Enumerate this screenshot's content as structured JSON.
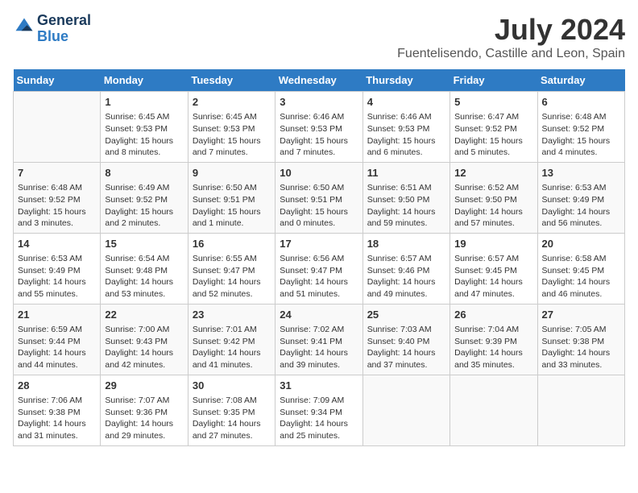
{
  "header": {
    "logo_line1": "General",
    "logo_line2": "Blue",
    "month": "July 2024",
    "location": "Fuentelisendo, Castille and Leon, Spain"
  },
  "days_of_week": [
    "Sunday",
    "Monday",
    "Tuesday",
    "Wednesday",
    "Thursday",
    "Friday",
    "Saturday"
  ],
  "weeks": [
    [
      {
        "num": "",
        "info": ""
      },
      {
        "num": "1",
        "info": "Sunrise: 6:45 AM\nSunset: 9:53 PM\nDaylight: 15 hours\nand 8 minutes."
      },
      {
        "num": "2",
        "info": "Sunrise: 6:45 AM\nSunset: 9:53 PM\nDaylight: 15 hours\nand 7 minutes."
      },
      {
        "num": "3",
        "info": "Sunrise: 6:46 AM\nSunset: 9:53 PM\nDaylight: 15 hours\nand 7 minutes."
      },
      {
        "num": "4",
        "info": "Sunrise: 6:46 AM\nSunset: 9:53 PM\nDaylight: 15 hours\nand 6 minutes."
      },
      {
        "num": "5",
        "info": "Sunrise: 6:47 AM\nSunset: 9:52 PM\nDaylight: 15 hours\nand 5 minutes."
      },
      {
        "num": "6",
        "info": "Sunrise: 6:48 AM\nSunset: 9:52 PM\nDaylight: 15 hours\nand 4 minutes."
      }
    ],
    [
      {
        "num": "7",
        "info": "Sunrise: 6:48 AM\nSunset: 9:52 PM\nDaylight: 15 hours\nand 3 minutes."
      },
      {
        "num": "8",
        "info": "Sunrise: 6:49 AM\nSunset: 9:52 PM\nDaylight: 15 hours\nand 2 minutes."
      },
      {
        "num": "9",
        "info": "Sunrise: 6:50 AM\nSunset: 9:51 PM\nDaylight: 15 hours\nand 1 minute."
      },
      {
        "num": "10",
        "info": "Sunrise: 6:50 AM\nSunset: 9:51 PM\nDaylight: 15 hours\nand 0 minutes."
      },
      {
        "num": "11",
        "info": "Sunrise: 6:51 AM\nSunset: 9:50 PM\nDaylight: 14 hours\nand 59 minutes."
      },
      {
        "num": "12",
        "info": "Sunrise: 6:52 AM\nSunset: 9:50 PM\nDaylight: 14 hours\nand 57 minutes."
      },
      {
        "num": "13",
        "info": "Sunrise: 6:53 AM\nSunset: 9:49 PM\nDaylight: 14 hours\nand 56 minutes."
      }
    ],
    [
      {
        "num": "14",
        "info": "Sunrise: 6:53 AM\nSunset: 9:49 PM\nDaylight: 14 hours\nand 55 minutes."
      },
      {
        "num": "15",
        "info": "Sunrise: 6:54 AM\nSunset: 9:48 PM\nDaylight: 14 hours\nand 53 minutes."
      },
      {
        "num": "16",
        "info": "Sunrise: 6:55 AM\nSunset: 9:47 PM\nDaylight: 14 hours\nand 52 minutes."
      },
      {
        "num": "17",
        "info": "Sunrise: 6:56 AM\nSunset: 9:47 PM\nDaylight: 14 hours\nand 51 minutes."
      },
      {
        "num": "18",
        "info": "Sunrise: 6:57 AM\nSunset: 9:46 PM\nDaylight: 14 hours\nand 49 minutes."
      },
      {
        "num": "19",
        "info": "Sunrise: 6:57 AM\nSunset: 9:45 PM\nDaylight: 14 hours\nand 47 minutes."
      },
      {
        "num": "20",
        "info": "Sunrise: 6:58 AM\nSunset: 9:45 PM\nDaylight: 14 hours\nand 46 minutes."
      }
    ],
    [
      {
        "num": "21",
        "info": "Sunrise: 6:59 AM\nSunset: 9:44 PM\nDaylight: 14 hours\nand 44 minutes."
      },
      {
        "num": "22",
        "info": "Sunrise: 7:00 AM\nSunset: 9:43 PM\nDaylight: 14 hours\nand 42 minutes."
      },
      {
        "num": "23",
        "info": "Sunrise: 7:01 AM\nSunset: 9:42 PM\nDaylight: 14 hours\nand 41 minutes."
      },
      {
        "num": "24",
        "info": "Sunrise: 7:02 AM\nSunset: 9:41 PM\nDaylight: 14 hours\nand 39 minutes."
      },
      {
        "num": "25",
        "info": "Sunrise: 7:03 AM\nSunset: 9:40 PM\nDaylight: 14 hours\nand 37 minutes."
      },
      {
        "num": "26",
        "info": "Sunrise: 7:04 AM\nSunset: 9:39 PM\nDaylight: 14 hours\nand 35 minutes."
      },
      {
        "num": "27",
        "info": "Sunrise: 7:05 AM\nSunset: 9:38 PM\nDaylight: 14 hours\nand 33 minutes."
      }
    ],
    [
      {
        "num": "28",
        "info": "Sunrise: 7:06 AM\nSunset: 9:38 PM\nDaylight: 14 hours\nand 31 minutes."
      },
      {
        "num": "29",
        "info": "Sunrise: 7:07 AM\nSunset: 9:36 PM\nDaylight: 14 hours\nand 29 minutes."
      },
      {
        "num": "30",
        "info": "Sunrise: 7:08 AM\nSunset: 9:35 PM\nDaylight: 14 hours\nand 27 minutes."
      },
      {
        "num": "31",
        "info": "Sunrise: 7:09 AM\nSunset: 9:34 PM\nDaylight: 14 hours\nand 25 minutes."
      },
      {
        "num": "",
        "info": ""
      },
      {
        "num": "",
        "info": ""
      },
      {
        "num": "",
        "info": ""
      }
    ]
  ]
}
